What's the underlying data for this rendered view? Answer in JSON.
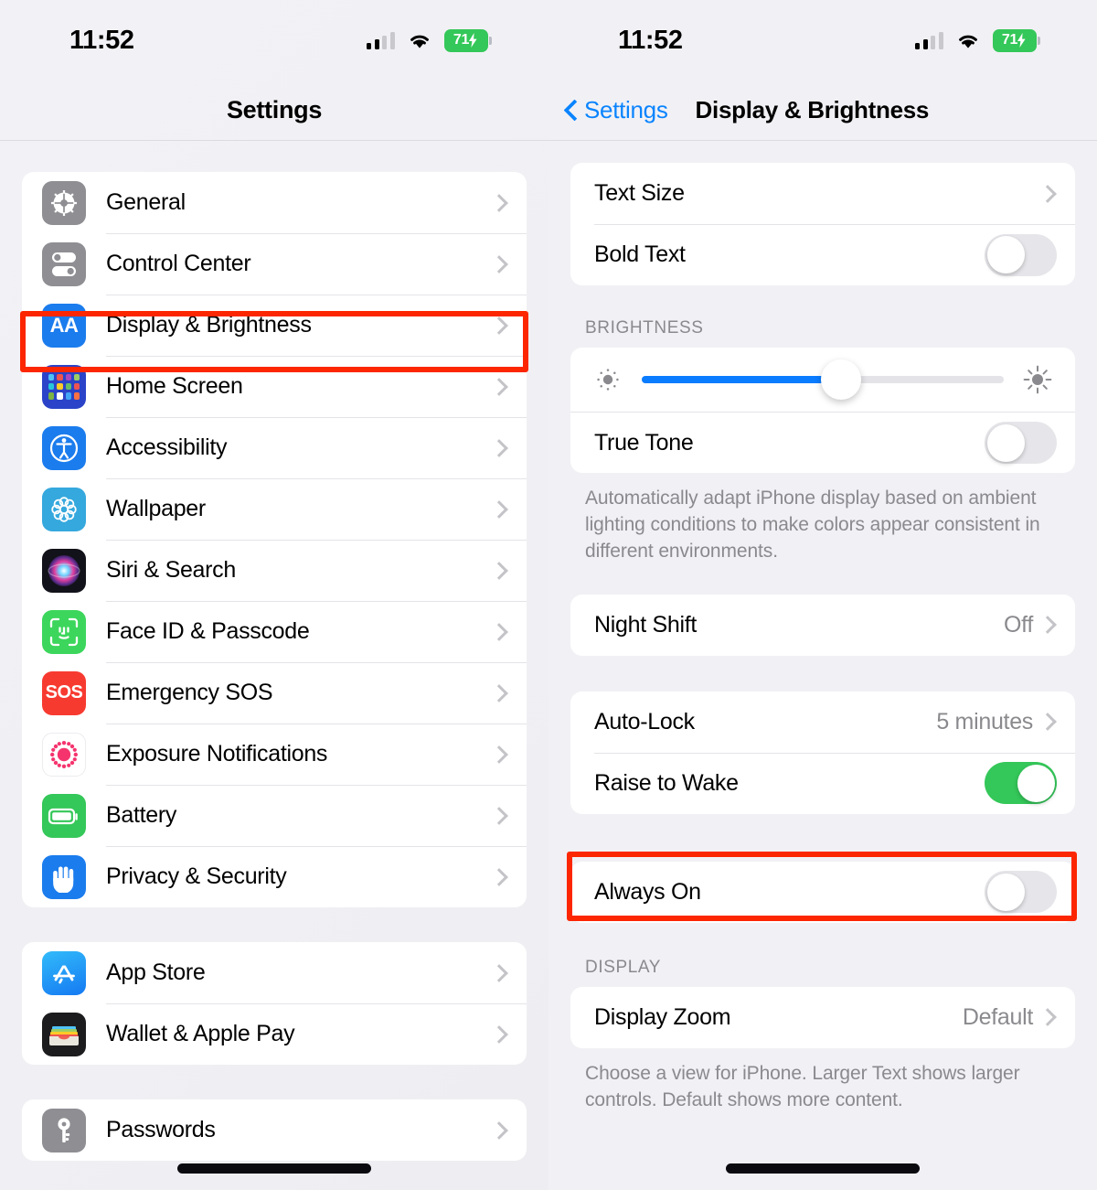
{
  "status_bar": {
    "time": "11:52",
    "battery_percent": "71",
    "battery_charging": true,
    "signal_bars_filled": 2,
    "signal_bars_total": 4,
    "wifi": "wifi-icon"
  },
  "left_pane": {
    "nav_title": "Settings",
    "groups": [
      {
        "items": [
          {
            "label": "General",
            "icon": "gear-icon",
            "icon_color": "#8e8e93",
            "accessory": "chevron"
          },
          {
            "label": "Control Center",
            "icon": "control-center-icon",
            "icon_color": "#8e8e93",
            "accessory": "chevron"
          },
          {
            "label": "Display & Brightness",
            "icon": "display-brightness-icon",
            "icon_color": "#1b7ced",
            "accessory": "chevron",
            "highlighted": true
          },
          {
            "label": "Home Screen",
            "icon": "home-screen-icon",
            "icon_color": "#2a43c8",
            "accessory": "chevron"
          },
          {
            "label": "Accessibility",
            "icon": "accessibility-icon",
            "icon_color": "#1b7ced",
            "accessory": "chevron"
          },
          {
            "label": "Wallpaper",
            "icon": "wallpaper-icon",
            "icon_color": "#35a8dd",
            "accessory": "chevron"
          },
          {
            "label": "Siri & Search",
            "icon": "siri-icon",
            "icon_color": "#1a1a22",
            "accessory": "chevron"
          },
          {
            "label": "Face ID & Passcode",
            "icon": "face-id-icon",
            "icon_color": "#3cd65c",
            "accessory": "chevron"
          },
          {
            "label": "Emergency SOS",
            "icon": "emergency-sos-icon",
            "icon_color": "#f73a30",
            "accessory": "chevron"
          },
          {
            "label": "Exposure Notifications",
            "icon": "exposure-notifications-icon",
            "icon_color": "#ffffff",
            "accessory": "chevron"
          },
          {
            "label": "Battery",
            "icon": "battery-icon",
            "icon_color": "#34c759",
            "accessory": "chevron"
          },
          {
            "label": "Privacy & Security",
            "icon": "privacy-security-icon",
            "icon_color": "#1b7ced",
            "accessory": "chevron"
          }
        ]
      },
      {
        "items": [
          {
            "label": "App Store",
            "icon": "app-store-icon",
            "icon_color": "#2196f9",
            "accessory": "chevron"
          },
          {
            "label": "Wallet & Apple Pay",
            "icon": "wallet-icon",
            "icon_color": "#1c1c1e",
            "accessory": "chevron"
          }
        ]
      },
      {
        "items": [
          {
            "label": "Passwords",
            "icon": "passwords-icon",
            "icon_color": "#8e8e93",
            "accessory": "chevron"
          }
        ]
      }
    ]
  },
  "right_pane": {
    "back_label": "Settings",
    "nav_title": "Display & Brightness",
    "sections": [
      {
        "header": "",
        "footer": "",
        "rows": [
          {
            "label": "Text Size",
            "accessory": "chevron",
            "value": ""
          },
          {
            "label": "Bold Text",
            "accessory": "toggle",
            "toggle_on": false
          }
        ]
      },
      {
        "header": "BRIGHTNESS",
        "footer": "Automatically adapt iPhone display based on ambient lighting conditions to make colors appear consistent in different environments.",
        "rows": [
          {
            "label": "",
            "accessory": "slider",
            "slider_percent": 55
          },
          {
            "label": "True Tone",
            "accessory": "toggle",
            "toggle_on": false
          }
        ]
      },
      {
        "header": "",
        "footer": "",
        "rows": [
          {
            "label": "Night Shift",
            "accessory": "chevron",
            "value": "Off"
          }
        ]
      },
      {
        "header": "",
        "footer": "",
        "rows": [
          {
            "label": "Auto-Lock",
            "accessory": "chevron",
            "value": "5 minutes"
          },
          {
            "label": "Raise to Wake",
            "accessory": "toggle",
            "toggle_on": true
          }
        ]
      },
      {
        "header": "",
        "footer": "",
        "highlighted": true,
        "rows": [
          {
            "label": "Always On",
            "accessory": "toggle",
            "toggle_on": false
          }
        ]
      },
      {
        "header": "DISPLAY",
        "footer": "Choose a view for iPhone. Larger Text shows larger controls. Default shows more content.",
        "rows": [
          {
            "label": "Display Zoom",
            "accessory": "chevron",
            "value": "Default"
          }
        ]
      }
    ]
  },
  "colors": {
    "accent_blue": "#0a84ff",
    "slider_blue": "#0a7cff",
    "toggle_green": "#34c759",
    "highlight_red": "#fc2600",
    "background": "#eff0f4",
    "card": "#ffffff"
  }
}
